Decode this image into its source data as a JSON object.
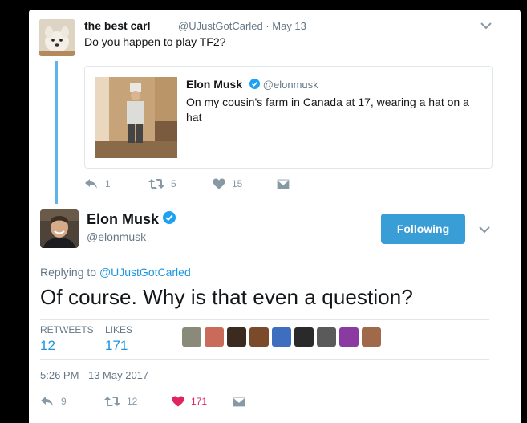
{
  "parent": {
    "name": "the best carl",
    "handle": "@UJustGotCarled",
    "date": "May 13",
    "text": "Do you happen to play TF2?",
    "quoted": {
      "name": "Elon Musk",
      "handle": "@elonmusk",
      "text": "On my cousin's farm in Canada at 17, wearing a hat on a hat"
    },
    "actions": {
      "replies": "1",
      "retweets": "5",
      "likes": "15"
    }
  },
  "main": {
    "name": "Elon Musk",
    "handle": "@elonmusk",
    "follow_label": "Following",
    "replying_prefix": "Replying to ",
    "replying_to": "@UJustGotCarled",
    "text": "Of course. Why is that even a question?",
    "stats": {
      "retweets_label": "RETWEETS",
      "retweets": "12",
      "likes_label": "LIKES",
      "likes": "171"
    },
    "timestamp": "5:26 PM - 13 May 2017",
    "actions": {
      "replies": "9",
      "retweets": "12",
      "likes": "171"
    }
  },
  "icons": [
    "chevron-down-icon",
    "verified-icon",
    "reply-icon",
    "retweet-icon",
    "heart-icon",
    "message-icon"
  ],
  "colors": {
    "accent": "#1b95e0",
    "follow_button": "#3a9ed6",
    "thread_line": "#5fb4e6",
    "liked": "#e0245e",
    "muted": "#8899a6"
  }
}
